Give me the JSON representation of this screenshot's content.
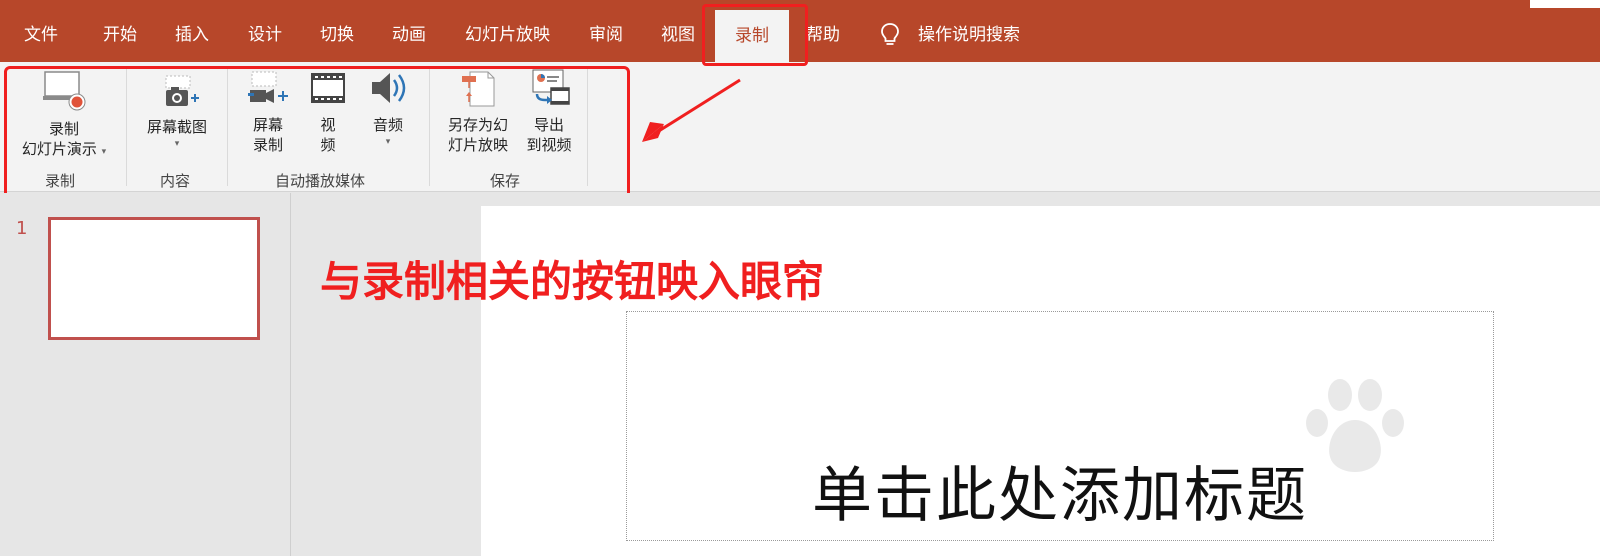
{
  "tabs": [
    {
      "id": "file",
      "label": "文件"
    },
    {
      "id": "home",
      "label": "开始"
    },
    {
      "id": "insert",
      "label": "插入"
    },
    {
      "id": "design",
      "label": "设计"
    },
    {
      "id": "transitions",
      "label": "切换"
    },
    {
      "id": "animations",
      "label": "动画"
    },
    {
      "id": "slideshow",
      "label": "幻灯片放映"
    },
    {
      "id": "review",
      "label": "审阅"
    },
    {
      "id": "view",
      "label": "视图"
    },
    {
      "id": "recording",
      "label": "录制"
    },
    {
      "id": "help",
      "label": "帮助"
    }
  ],
  "active_tab": "录制",
  "tell_me": "操作说明搜索",
  "ribbon": {
    "record_group": {
      "label": "录制",
      "record_slideshow": {
        "line1": "录制",
        "line2": "幻灯片演示"
      }
    },
    "content_group": {
      "label": "内容",
      "screenshot": {
        "line1": "屏幕截图"
      }
    },
    "media_group": {
      "label": "自动播放媒体",
      "screen_recording": {
        "line1": "屏幕",
        "line2": "录制"
      },
      "video": {
        "line1": "视",
        "line2": "频"
      },
      "audio": {
        "line1": "音频"
      }
    },
    "save_group": {
      "label": "保存",
      "save_as_show": {
        "line1": "另存为幻",
        "line2": "灯片放映"
      },
      "export_video": {
        "line1": "导出",
        "line2": "到视频"
      }
    }
  },
  "slides": {
    "number": "1"
  },
  "slide": {
    "title_placeholder": "单击此处添加标题"
  },
  "annotation": {
    "text": "与录制相关的按钮映入眼帘"
  },
  "colors": {
    "accent": "#b7472a",
    "annotation": "#f01f1f"
  }
}
